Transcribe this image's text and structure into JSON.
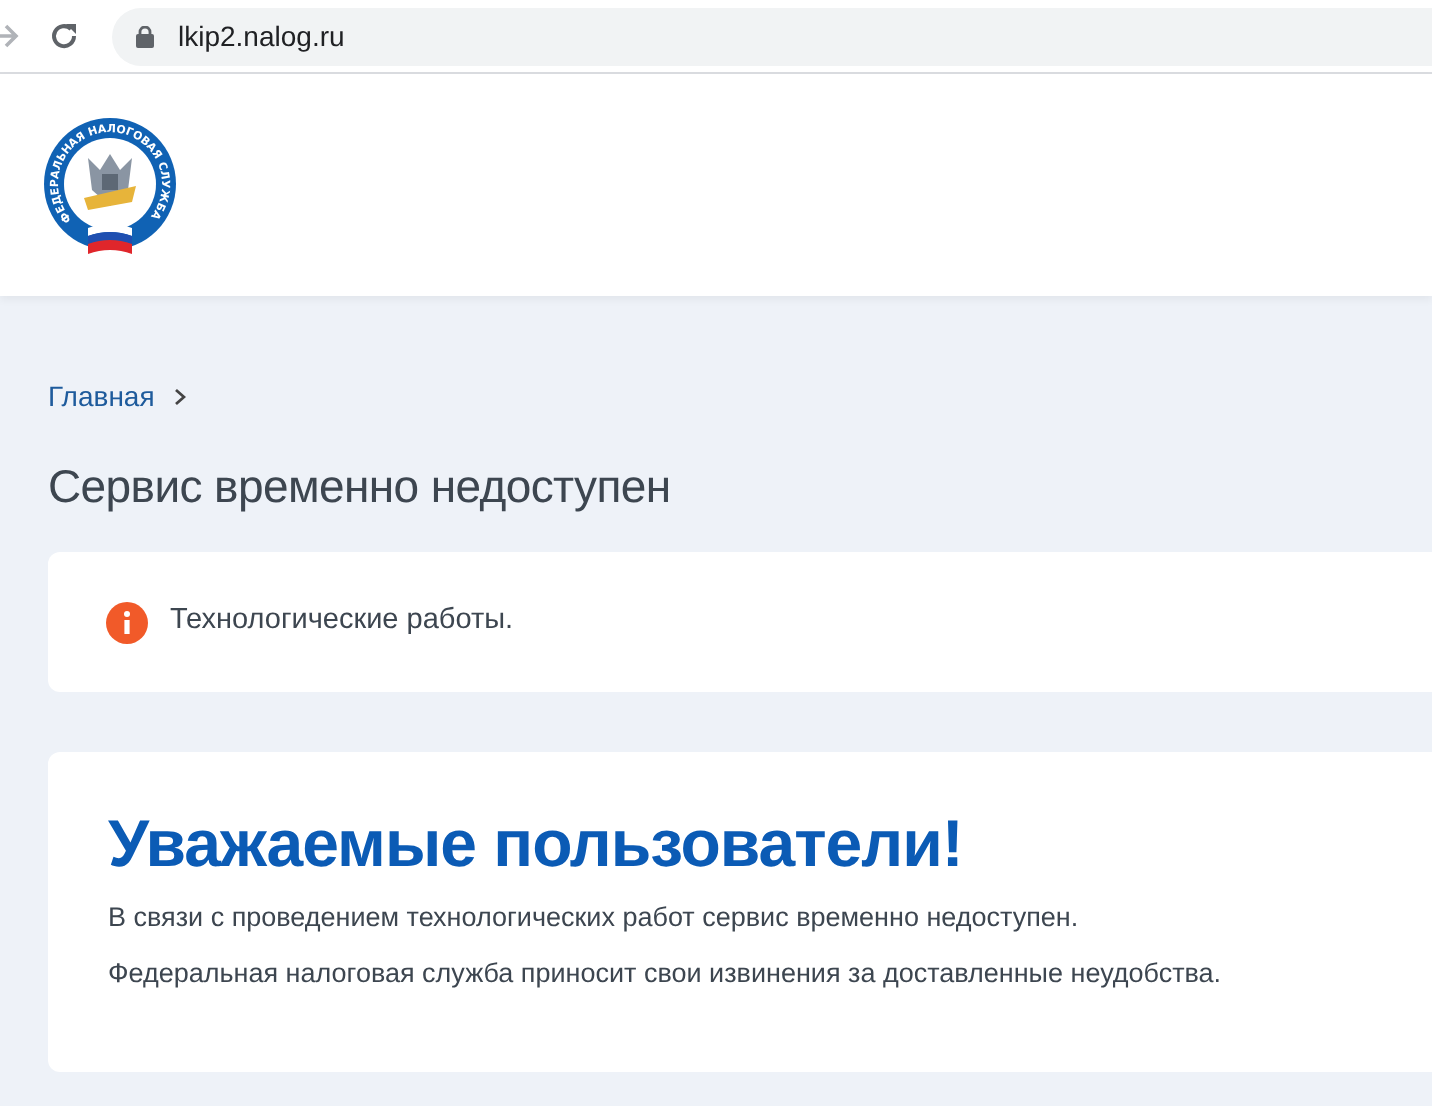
{
  "browser": {
    "url": "lkip2.nalog.ru"
  },
  "header": {
    "logo_text": "ФЕДЕРАЛЬНАЯ НАЛОГОВАЯ СЛУЖБА"
  },
  "breadcrumbs": [
    {
      "label": "Главная"
    }
  ],
  "page_title": "Сервис временно недоступен",
  "notice": {
    "text": "Технологические работы."
  },
  "message": {
    "heading": "Уважаемые пользователи!",
    "paragraphs": [
      "В связи с проведением технологических работ сервис временно недоступен.",
      "Федеральная налоговая служба приносит свои извинения за доставленные неудобства."
    ]
  }
}
